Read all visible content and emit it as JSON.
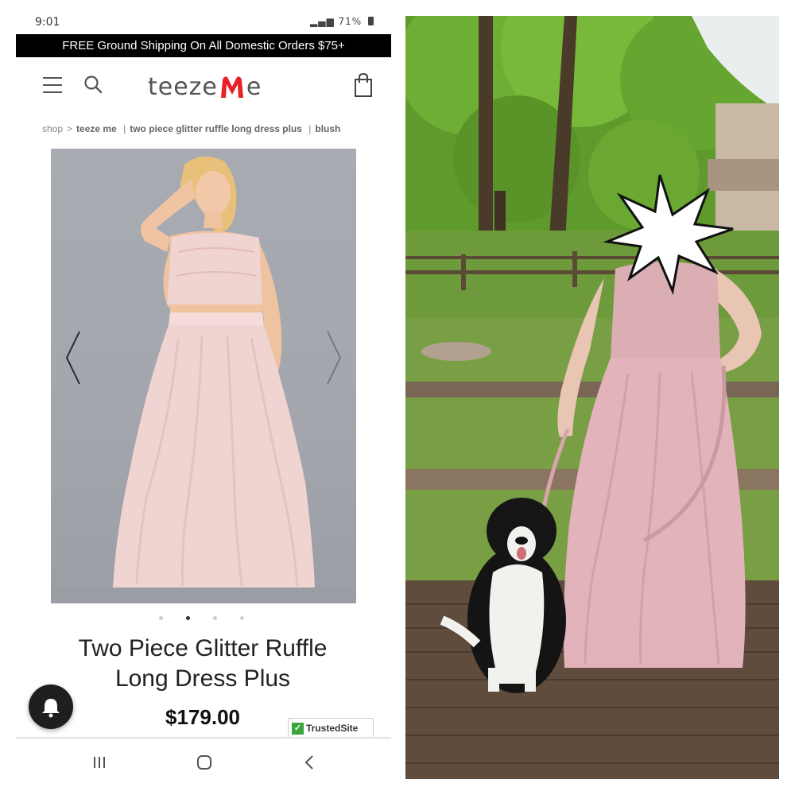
{
  "status_bar": {
    "time": "9:01",
    "battery": "71%"
  },
  "banner": {
    "text": "FREE Ground Shipping On All Domestic Orders $75+"
  },
  "header": {
    "logo_text_left": "teeze",
    "logo_text_right": "e"
  },
  "breadcrumb": {
    "shop": "shop",
    "sep": ">",
    "brand": "teeze me",
    "product": "two piece glitter ruffle long dress plus",
    "color": "blush",
    "divider": "|"
  },
  "product": {
    "title_line1": "Two Piece Glitter Ruffle",
    "title_line2": "Long Dress Plus",
    "price": "$179.00"
  },
  "carousel": {
    "total_images": 4,
    "active_index": 1
  },
  "trusted_badge": {
    "label": "TrustedSite",
    "check": "✓"
  },
  "colors": {
    "banner_bg": "#000000",
    "logo_accent": "#e8202a",
    "dress_pink": "#f0d4d2",
    "trusted_green": "#3aa53a"
  },
  "icons": [
    "menu-icon",
    "search-icon",
    "shopping-bag-icon",
    "bell-icon",
    "chevron-left-icon",
    "chevron-right-icon",
    "recent-apps-icon",
    "home-icon",
    "back-icon"
  ]
}
